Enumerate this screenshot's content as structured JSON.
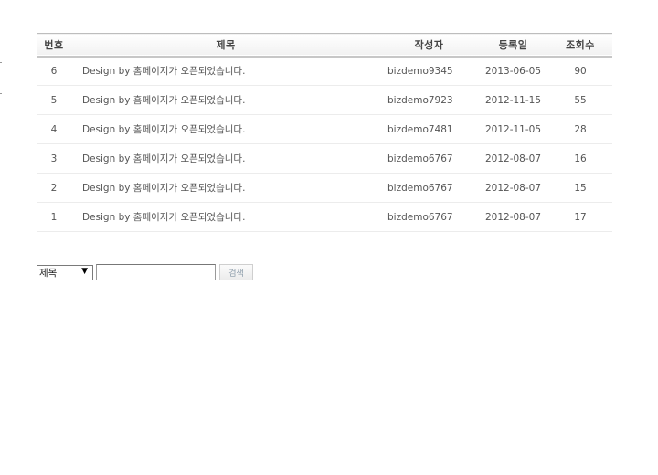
{
  "board": {
    "columns": {
      "num": "번호",
      "title": "제목",
      "author": "작성자",
      "date": "등록일",
      "hits": "조회수"
    },
    "rows": [
      {
        "num": "6",
        "title": "Design by 홈페이지가 오픈되었습니다.",
        "author": "bizdemo9345",
        "date": "2013-06-05",
        "hits": "90"
      },
      {
        "num": "5",
        "title": "Design by 홈페이지가 오픈되었습니다.",
        "author": "bizdemo7923",
        "date": "2012-11-15",
        "hits": "55"
      },
      {
        "num": "4",
        "title": "Design by 홈페이지가 오픈되었습니다.",
        "author": "bizdemo7481",
        "date": "2012-11-05",
        "hits": "28"
      },
      {
        "num": "3",
        "title": "Design by 홈페이지가 오픈되었습니다.",
        "author": "bizdemo6767",
        "date": "2012-08-07",
        "hits": "16"
      },
      {
        "num": "2",
        "title": "Design by 홈페이지가 오픈되었습니다.",
        "author": "bizdemo6767",
        "date": "2012-08-07",
        "hits": "15"
      },
      {
        "num": "1",
        "title": "Design by 홈페이지가 오픈되었습니다.",
        "author": "bizdemo6767",
        "date": "2012-08-07",
        "hits": "17"
      }
    ]
  },
  "search": {
    "field_selected": "제목",
    "keyword_value": "",
    "button_label": "검색",
    "dropdown_icon": "caret-down-icon"
  }
}
